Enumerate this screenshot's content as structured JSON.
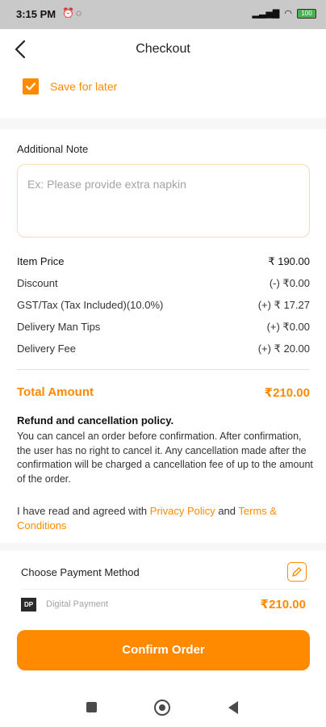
{
  "status_bar": {
    "time": "3:15 PM",
    "left_icons": [
      "alarm-icon",
      "whatsapp-icon"
    ],
    "right_icons": [
      "signal-icon",
      "wifi-icon",
      "battery-icon"
    ],
    "battery_label": "100"
  },
  "header": {
    "title": "Checkout"
  },
  "save_for_later": {
    "label": "Save for later",
    "checked": true
  },
  "note": {
    "label": "Additional Note",
    "placeholder": "Ex: Please provide extra napkin"
  },
  "summary": {
    "rows": [
      {
        "label": "Item Price",
        "value": "₹ 190.00"
      },
      {
        "label": "Discount",
        "value": "(-) ₹0.00"
      },
      {
        "label": "GST/Tax (Tax Included)(10.0%)",
        "value": "(+) ₹ 17.27"
      },
      {
        "label": "Delivery Man Tips",
        "value": "(+) ₹0.00"
      },
      {
        "label": "Delivery Fee",
        "value": "(+) ₹ 20.00"
      }
    ],
    "total_label": "Total Amount",
    "total_value": "₹210.00"
  },
  "policy": {
    "title": "Refund and cancellation policy.",
    "text": "You can cancel an order before confirmation. After confirmation, the user has no right to cancel it. Any cancellation made after the confirmation will be charged a cancellation fee of up to the amount of the order."
  },
  "agreement": {
    "prefix": "I have read and agreed with ",
    "privacy_link": "Privacy Policy",
    "conjunction": " and ",
    "terms_link": "Terms & Conditions"
  },
  "payment": {
    "title": "Choose Payment Method",
    "method_icon_text": "DP",
    "method": "Digital Payment",
    "amount": "₹210.00"
  },
  "confirm_button": "Confirm Order",
  "nav_bar": {
    "icons": [
      "recent-apps-icon",
      "home-icon",
      "back-icon"
    ]
  },
  "colors": {
    "accent": "#ff8a00",
    "status_bar": "#c9c9c9",
    "muted": "#a3a3a3"
  }
}
